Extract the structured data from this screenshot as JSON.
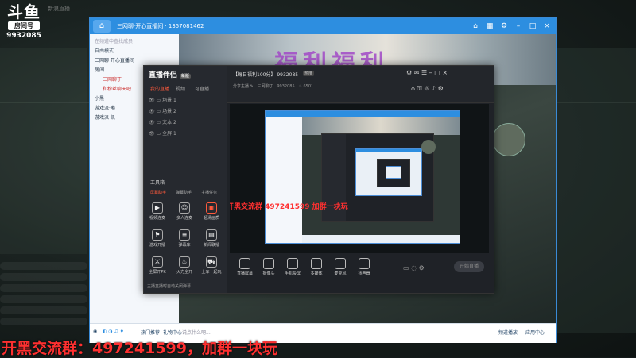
{
  "douyu": {
    "logo": "斗鱼",
    "sub": "房间号",
    "room_id": "9932085"
  },
  "top_strip": "新浪直播 ...",
  "yy": {
    "title": "三网聊·开心直播间 · 1357081462",
    "left_panel": {
      "search_placeholder": "在频道中查找成员",
      "mode": "自由模式",
      "items": [
        "三网聊·开心直播间",
        "房间",
        "三网聊丁",
        "和粉丝聊天吧",
        "小黑",
        "游戏派·嘟",
        "游戏派·凯"
      ]
    },
    "input_placeholder": "说点什么吧...",
    "bottom_left": [
      "热门推荐",
      "礼物中心"
    ],
    "bottom_right": [
      "频道播放",
      "应用中心"
    ]
  },
  "zb": {
    "logo": "直播伴侣",
    "version": "新版",
    "tabs": [
      "我的直播",
      "视频",
      "可直播"
    ],
    "scenes": [
      "场景 1",
      "场景 2",
      "文本 2",
      "全屏 1"
    ],
    "tools_label": "工具箱",
    "tool_tabs": [
      "屏幕助手",
      "弹幕助手",
      "主播任务"
    ],
    "tools": [
      "视频连麦",
      "多人连麦",
      "超清画质",
      "游戏开播",
      "弹幕库",
      "新闻联播",
      "全屏开PK",
      "火力全开",
      "上车一起玩"
    ],
    "bottom_hint": "主播直播时自动关闭弹幕",
    "header_title": "【每日福利100分】 9932085",
    "header_tag": "热度",
    "header_sub": [
      "分享主播",
      "三网聊丁",
      "9932085",
      "6501"
    ],
    "footer_buttons": [
      "直播屏幕",
      "摄像头",
      "手机投屏",
      "多媒体",
      "麦克风",
      "扬声器"
    ],
    "start_label": "开始直播"
  },
  "overlay_text": "开黑交流群：497241599，加群一块玩",
  "overlay_small": "开黑交流群 497241599 加群一块玩"
}
